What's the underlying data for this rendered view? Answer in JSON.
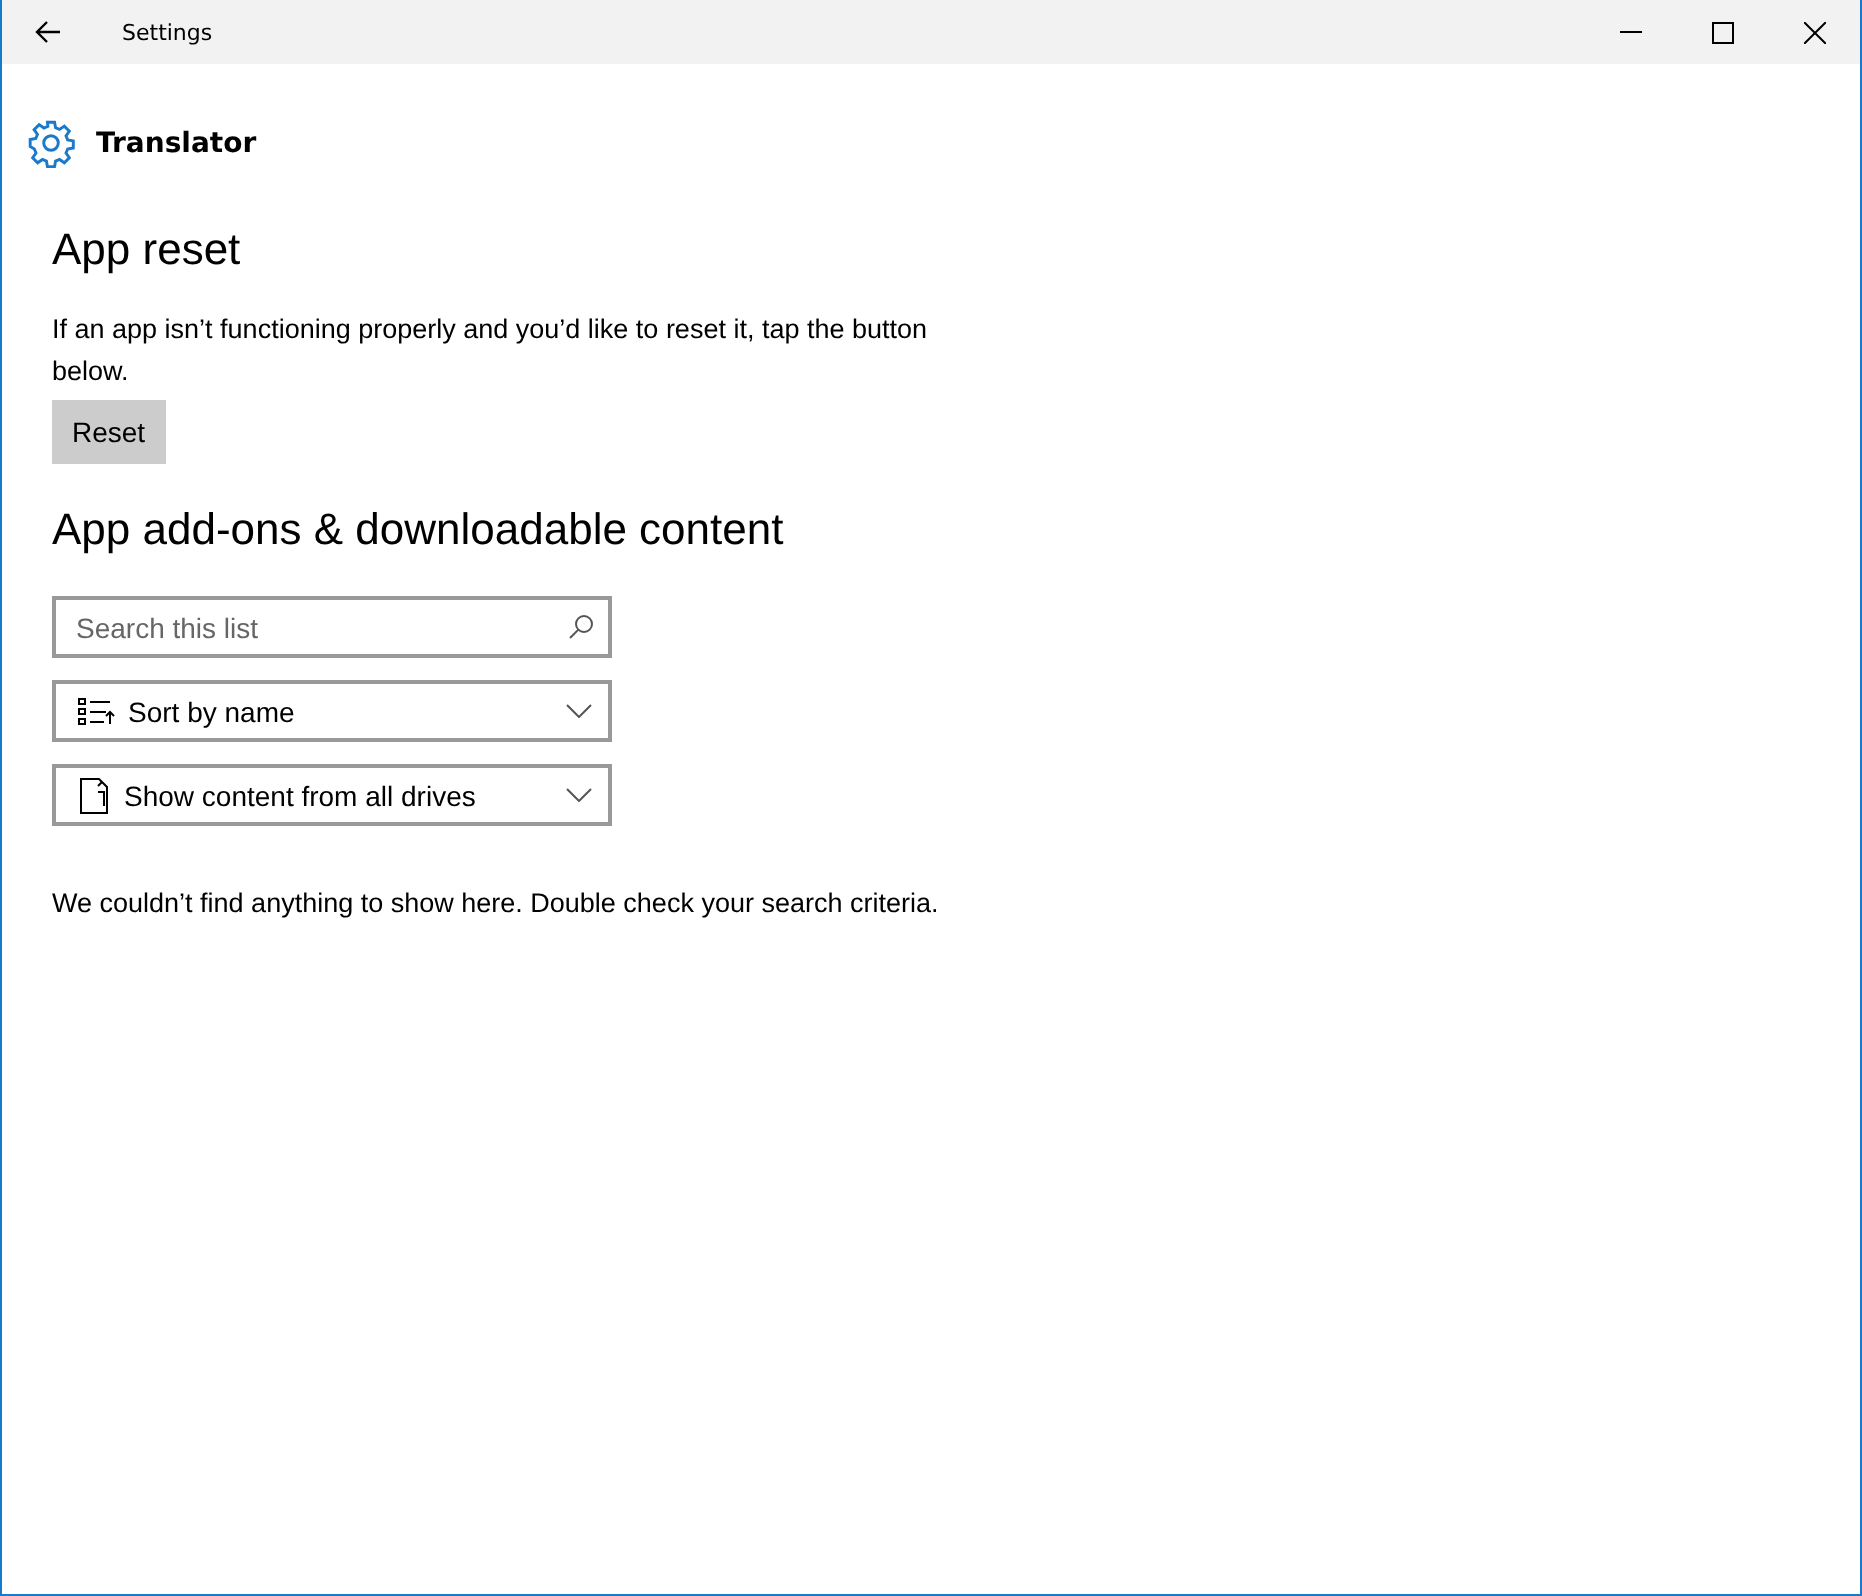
{
  "window": {
    "title": "Settings"
  },
  "app": {
    "name": "Translator"
  },
  "reset_section": {
    "heading": "App reset",
    "description": "If an app isn’t functioning properly and you’d like to reset it, tap the button below.",
    "button": "Reset"
  },
  "addons_section": {
    "heading": "App add-ons & downloadable content",
    "search": {
      "placeholder": "Search this list"
    },
    "dropdowns": [
      {
        "kind": "sort",
        "value": "Sort by name"
      },
      {
        "kind": "drives",
        "value": "Show content from all drives"
      }
    ],
    "empty_message": "We couldn’t find anything to show here. Double check your search criteria."
  }
}
